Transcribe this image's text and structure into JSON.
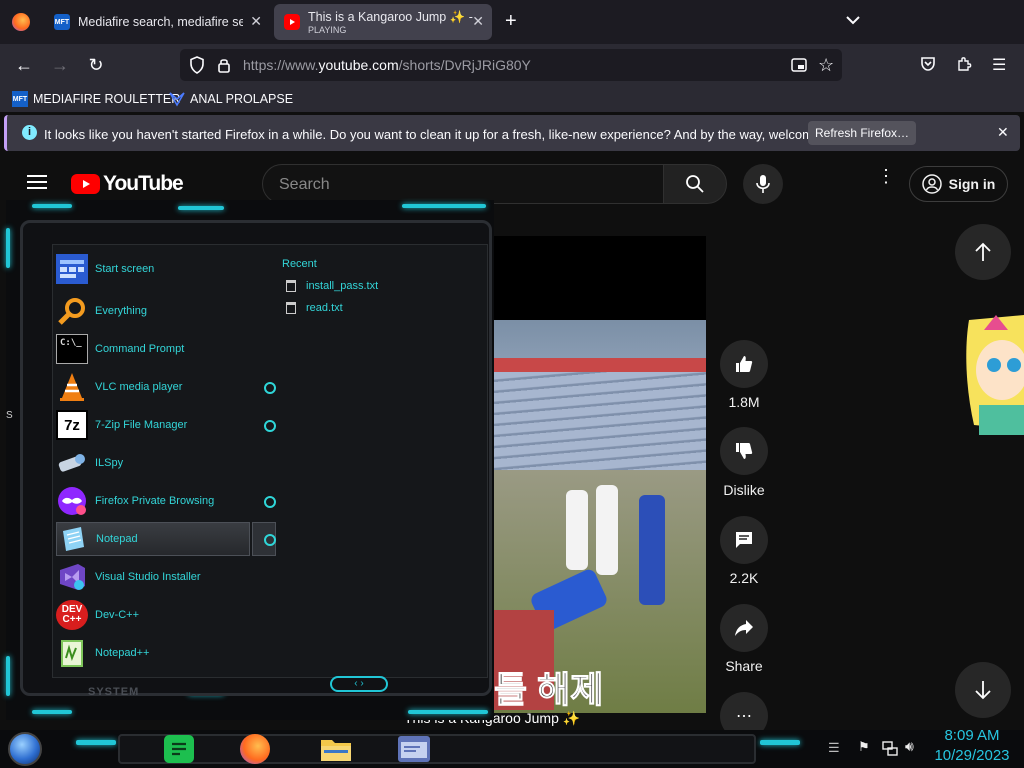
{
  "tabs": [
    {
      "title": "Mediafire search, mediafire search engine",
      "favicon": "MFT"
    },
    {
      "title": "This is a Kangaroo Jump ✨ - YouTube",
      "subtitle": "PLAYING"
    }
  ],
  "url": {
    "prefix": "https://www.",
    "domain": "youtube.com",
    "path": "/shorts/DvRjJRiG80Y"
  },
  "bookmarks": [
    {
      "label": "MEDIAFIRE ROULETTER",
      "icon": "MFT"
    },
    {
      "label": "ANAL PROLAPSE"
    }
  ],
  "notification": {
    "message": "It looks like you haven't started Firefox in a while. Do you want to clean it up for a fresh, like-new experience? And by the way, welcome back!",
    "button": "Refresh Firefox…"
  },
  "youtube": {
    "logo": "YouTube",
    "search_placeholder": "Search",
    "signin": "Sign in",
    "likes": "1.8M",
    "dislike": "Dislike",
    "comments": "2.2K",
    "share": "Share",
    "video_title": "This is a Kangaroo Jump ✨",
    "caption_overlay": "틀 해제"
  },
  "start_menu": {
    "items": [
      {
        "label": "Start screen",
        "icon": "start-screen-icon"
      },
      {
        "label": "Everything",
        "icon": "search-icon"
      },
      {
        "label": "Command Prompt",
        "icon": "command-prompt-icon"
      },
      {
        "label": "VLC media player",
        "icon": "vlc-icon"
      },
      {
        "label": "7-Zip File Manager",
        "icon": "seven-zip-icon"
      },
      {
        "label": "ILSpy",
        "icon": "ilspy-icon"
      },
      {
        "label": "Firefox Private Browsing",
        "icon": "private-browsing-icon"
      },
      {
        "label": "Notepad",
        "icon": "notepad-icon"
      },
      {
        "label": "Visual Studio Installer",
        "icon": "visual-studio-icon"
      },
      {
        "label": "Dev-C++",
        "icon": "devcpp-icon"
      },
      {
        "label": "Notepad++",
        "icon": "notepadpp-icon"
      }
    ],
    "recent_title": "Recent",
    "recent": [
      "install_pass.txt",
      "read.txt"
    ],
    "footer": "SYSTEM",
    "side_letter": "S"
  },
  "taskbar": {
    "time": "8:09 AM",
    "date": "10/29/2023"
  },
  "colors": {
    "accent": "#33d5d8",
    "youtube_red": "#ff0000",
    "firefox_bg": "#2b2a33"
  }
}
